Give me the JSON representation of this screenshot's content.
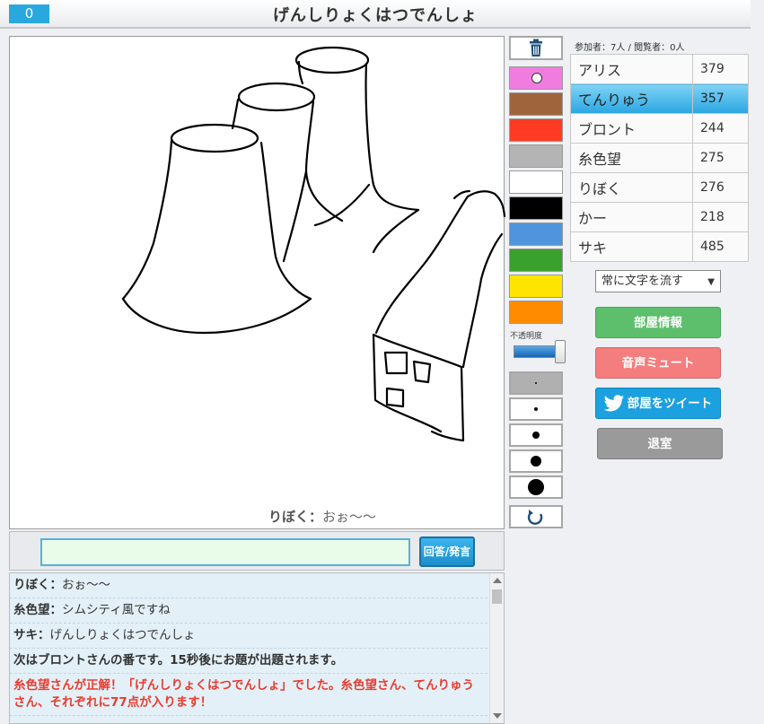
{
  "header": {
    "turn_counter": "0",
    "topic": "げんしりょくはつでんしょ"
  },
  "canvas": {
    "overlay_name": "りぼく：",
    "overlay_text": "おぉ～～"
  },
  "answer": {
    "input_value": "",
    "button_label": "回答/発言"
  },
  "chat": [
    {
      "name": "りぼく：",
      "text": "おぉ～～",
      "kind": "user"
    },
    {
      "name": "糸色望：",
      "text": "シムシティ風ですね",
      "kind": "user"
    },
    {
      "name": "サキ：",
      "text": "げんしりょくはつでんしょ",
      "kind": "user"
    },
    {
      "name": "",
      "text": "次はブロントさんの番です。15秒後にお題が出題されます。",
      "kind": "system"
    },
    {
      "name": "",
      "text": "糸色望さんが正解！「げんしりょくはつでんしょ」でした。糸色望さん、てんりゅうさん、それぞれに77点が入ります！",
      "kind": "correct"
    }
  ],
  "tools": {
    "trash_icon": "trash-icon",
    "opacity_label": "不透明度",
    "opacity_value": 1.0,
    "undo_icon": "undo-icon",
    "colors": [
      "#f07ce0",
      "#a0643c",
      "#ff3b23",
      "#b4b4b4",
      "#ffffff",
      "#000000",
      "#4f94dc",
      "#3aa02e",
      "#ffe400",
      "#ff8c00"
    ],
    "selected_color": "#f07ce0"
  },
  "room": {
    "participants_label": "参加者：7人 / 閲覧者：0人"
  },
  "players": [
    {
      "name": "アリス",
      "score": "379",
      "active": false
    },
    {
      "name": "てんりゅう",
      "score": "357",
      "active": true
    },
    {
      "name": "ブロント",
      "score": "244",
      "active": false
    },
    {
      "name": "糸色望",
      "score": "275",
      "active": false
    },
    {
      "name": "りぼく",
      "score": "276",
      "active": false
    },
    {
      "name": "かー",
      "score": "218",
      "active": false
    },
    {
      "name": "サキ",
      "score": "485",
      "active": false
    }
  ],
  "sidebar": {
    "scroll_mode": "常に文字を流す",
    "room_info": "部屋情報",
    "mute": "音声ミュート",
    "tweet": "部屋をツイート",
    "exit": "退室"
  }
}
